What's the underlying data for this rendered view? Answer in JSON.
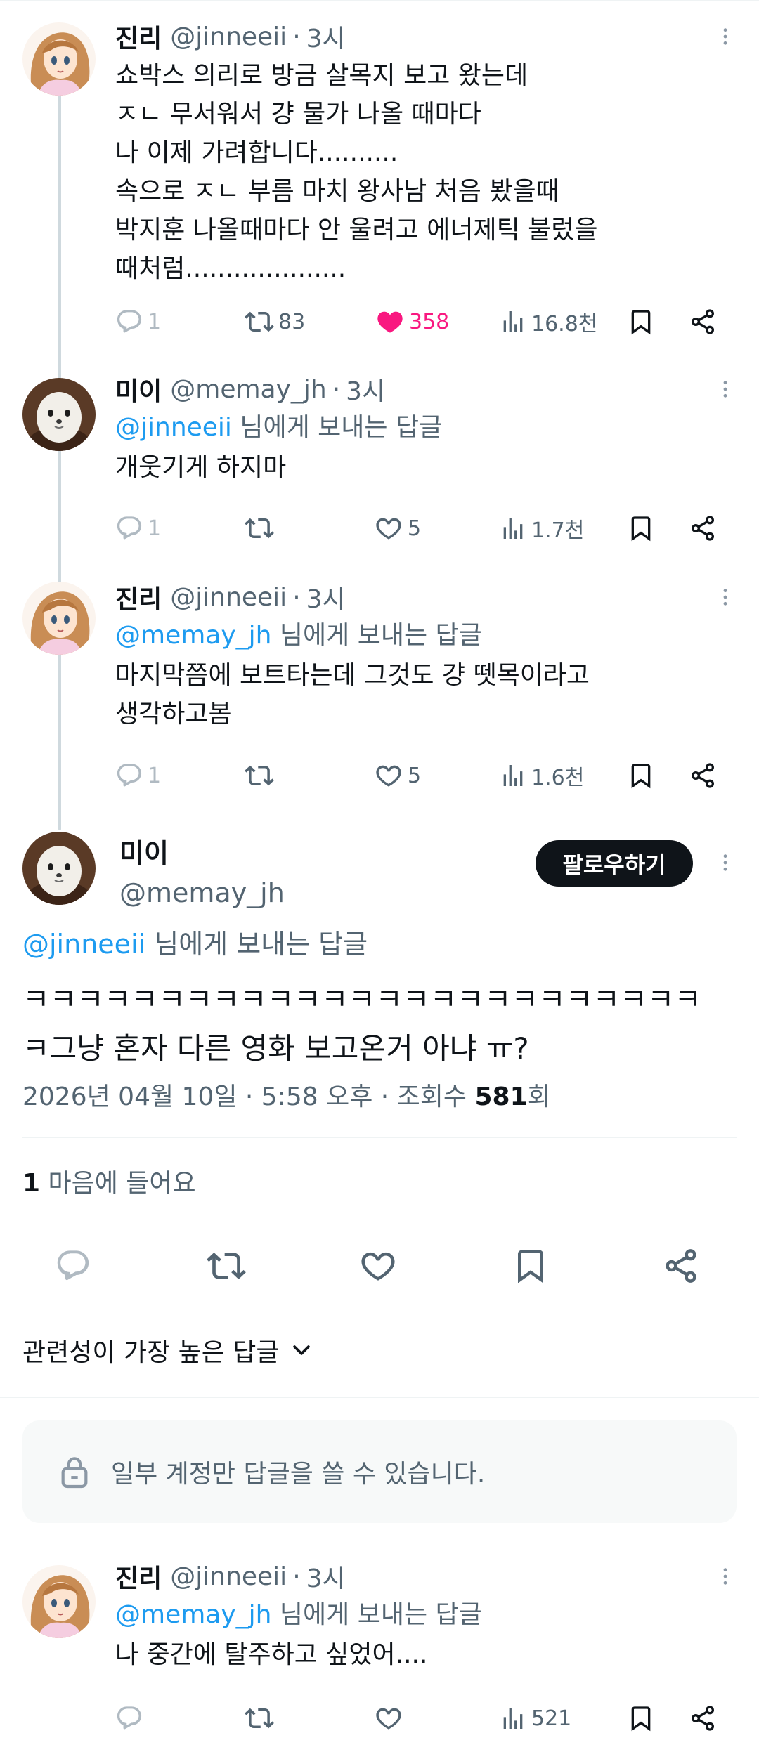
{
  "tweets": [
    {
      "name": "진리",
      "handle": "@jinneeii",
      "time": "3시",
      "body": "쇼박스 의리로 방금 살목지 보고 왔는데\nㅈㄴ 무서워서 걍 물가 나올 때마다\n나 이제 가려합니다..........\n속으로 ㅈㄴ 부름 마치 왕사남 처음 봤을때\n박지훈 나올때마다 안 울려고 에너제틱 불렀을\n때처럼....................",
      "replies": "1",
      "retweets": "83",
      "likes": "358",
      "views": "16.8천"
    },
    {
      "name": "미이",
      "handle": "@memay_jh",
      "time": "3시",
      "reply_mention": "@jinneeii",
      "reply_suffix": " 님에게 보내는 답글",
      "body": "개웃기게 하지마",
      "replies": "1",
      "retweets": "",
      "likes": "5",
      "views": "1.7천"
    },
    {
      "name": "진리",
      "handle": "@jinneeii",
      "time": "3시",
      "reply_mention": "@memay_jh",
      "reply_suffix": " 님에게 보내는 답글",
      "body": "마지막쯤에 보트타는데 그것도 걍 뗏목이라고\n생각하고봄",
      "replies": "1",
      "retweets": "",
      "likes": "5",
      "views": "1.6천"
    }
  ],
  "focus": {
    "name": "미이",
    "handle": "@memay_jh",
    "follow_label": "팔로우하기",
    "reply_mention": "@jinneeii",
    "reply_suffix": " 님에게 보내는 답글",
    "text": "ㅋㅋㅋㅋㅋㅋㅋㅋㅋㅋㅋㅋㅋㅋㅋㅋㅋㅋㅋㅋㅋㅋㅋㅋㅋ\nㅋ그냥 혼자 다른 영화 보고온거 아냐 ㅠ?",
    "date": "2026년 04월 10일 · 5:58 오후 · 조회수 ",
    "views": "581",
    "views_suffix": "회",
    "likes_count": "1",
    "likes_label": " 마음에 들어요"
  },
  "sort_label": "관련성이 가장 높은 답글",
  "notice": "일부 계정만 답글을 쓸 수 있습니다.",
  "last_reply": {
    "name": "진리",
    "handle": "@jinneeii",
    "time": "3시",
    "reply_mention": "@memay_jh",
    "reply_suffix": " 님에게 보내는 답글",
    "body": "나 중간에 탈주하고 싶었어....",
    "views": "521"
  },
  "separator": "·",
  "colors": {
    "accent": "#1d9bf0",
    "like": "#f91880",
    "text": "#0f1419",
    "muted": "#536471"
  }
}
